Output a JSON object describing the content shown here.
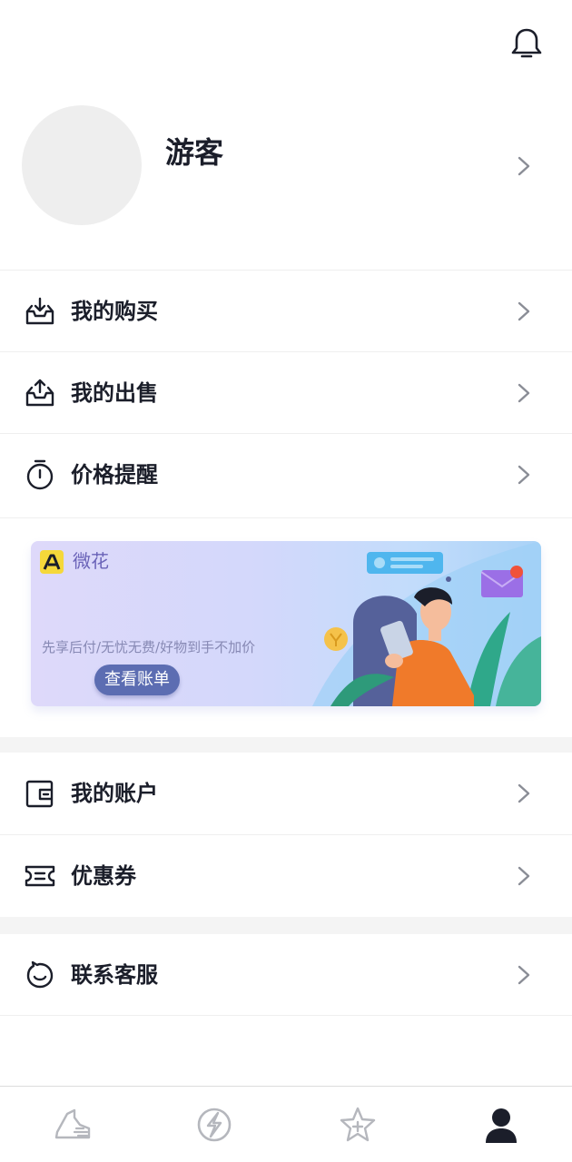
{
  "header": {
    "notification_icon": "bell-icon"
  },
  "profile": {
    "name": "游客",
    "avatar": "avatar-placeholder",
    "chevron_icon": "chevron-right-icon"
  },
  "menu_primary": [
    {
      "label": "我的购买",
      "icon": "inbox-download-icon"
    },
    {
      "label": "我的出售",
      "icon": "inbox-upload-icon"
    },
    {
      "label": "价格提醒",
      "icon": "stopwatch-icon"
    }
  ],
  "banner": {
    "brand": "微花",
    "description": "先享后付/无忧无费/好物到手不加价",
    "button_label": "查看账单"
  },
  "menu_secondary": [
    {
      "label": "我的账户",
      "icon": "wallet-icon"
    },
    {
      "label": "优惠券",
      "icon": "coupon-icon"
    }
  ],
  "menu_tertiary": [
    {
      "label": "联系客服",
      "icon": "customer-service-icon"
    }
  ],
  "tabbar": {
    "tabs": [
      {
        "icon": "sneaker-icon",
        "active": false
      },
      {
        "icon": "lightning-circle-icon",
        "active": false
      },
      {
        "icon": "star-plus-icon",
        "active": false
      },
      {
        "icon": "user-icon",
        "active": true
      }
    ],
    "active_color": "#1b1e2a",
    "inactive_color": "#b5b7bd"
  },
  "colors": {
    "text_primary": "#1b1e2a",
    "divider": "#efefef",
    "section_gap": "#f4f4f4",
    "avatar_bg": "#eeeeee",
    "banner_button": "#5c6db2",
    "brand_logo": "#f5d83a"
  }
}
